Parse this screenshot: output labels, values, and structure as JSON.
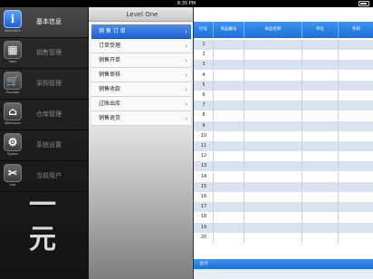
{
  "status_bar": {
    "time": "8:35 PM"
  },
  "sidebar": {
    "items": [
      {
        "label": "基本信息",
        "icon_name": "info-icon",
        "glyph": "i",
        "caption": "Information",
        "active": true
      },
      {
        "label": "销售管理",
        "icon_name": "sales-grid-icon",
        "glyph": "▦",
        "caption": "Sales",
        "active": false
      },
      {
        "label": "采购管理",
        "icon_name": "purchase-cart-icon",
        "glyph": "🛒",
        "caption": "Purchase",
        "active": false
      },
      {
        "label": "仓库管理",
        "icon_name": "warehouse-house-icon",
        "glyph": "⌂",
        "caption": "Warehouse",
        "active": false
      },
      {
        "label": "系统设置",
        "icon_name": "system-gear-icon",
        "glyph": "⚙",
        "caption": "System",
        "active": false
      },
      {
        "label": "当前用户",
        "icon_name": "user-tools-icon",
        "glyph": "✂",
        "caption": "User",
        "active": false
      }
    ],
    "logo_chars": [
      "一",
      "元"
    ]
  },
  "menu": {
    "title": "Level One",
    "items": [
      {
        "label": "销 售 订 单",
        "active": true
      },
      {
        "label": "订单受理",
        "active": false
      },
      {
        "label": "销售开单",
        "active": false
      },
      {
        "label": "销售审核",
        "active": false
      },
      {
        "label": "销售收款",
        "active": false
      },
      {
        "label": "过账出库",
        "active": false
      },
      {
        "label": "销售退货",
        "active": false
      }
    ]
  },
  "table": {
    "headers": [
      "行号",
      "商品编号",
      "商品名称",
      "单位",
      "条码"
    ],
    "rows": [
      "1",
      "2",
      "3",
      "4",
      "5",
      "6",
      "7",
      "8",
      "9",
      "10",
      "11",
      "12",
      "13",
      "14",
      "15",
      "16",
      "17",
      "18",
      "19",
      "20"
    ],
    "footer_label": "合计"
  },
  "colors": {
    "accent_blue": "#1f63d6",
    "row_stripe": "#d9e3ef"
  }
}
